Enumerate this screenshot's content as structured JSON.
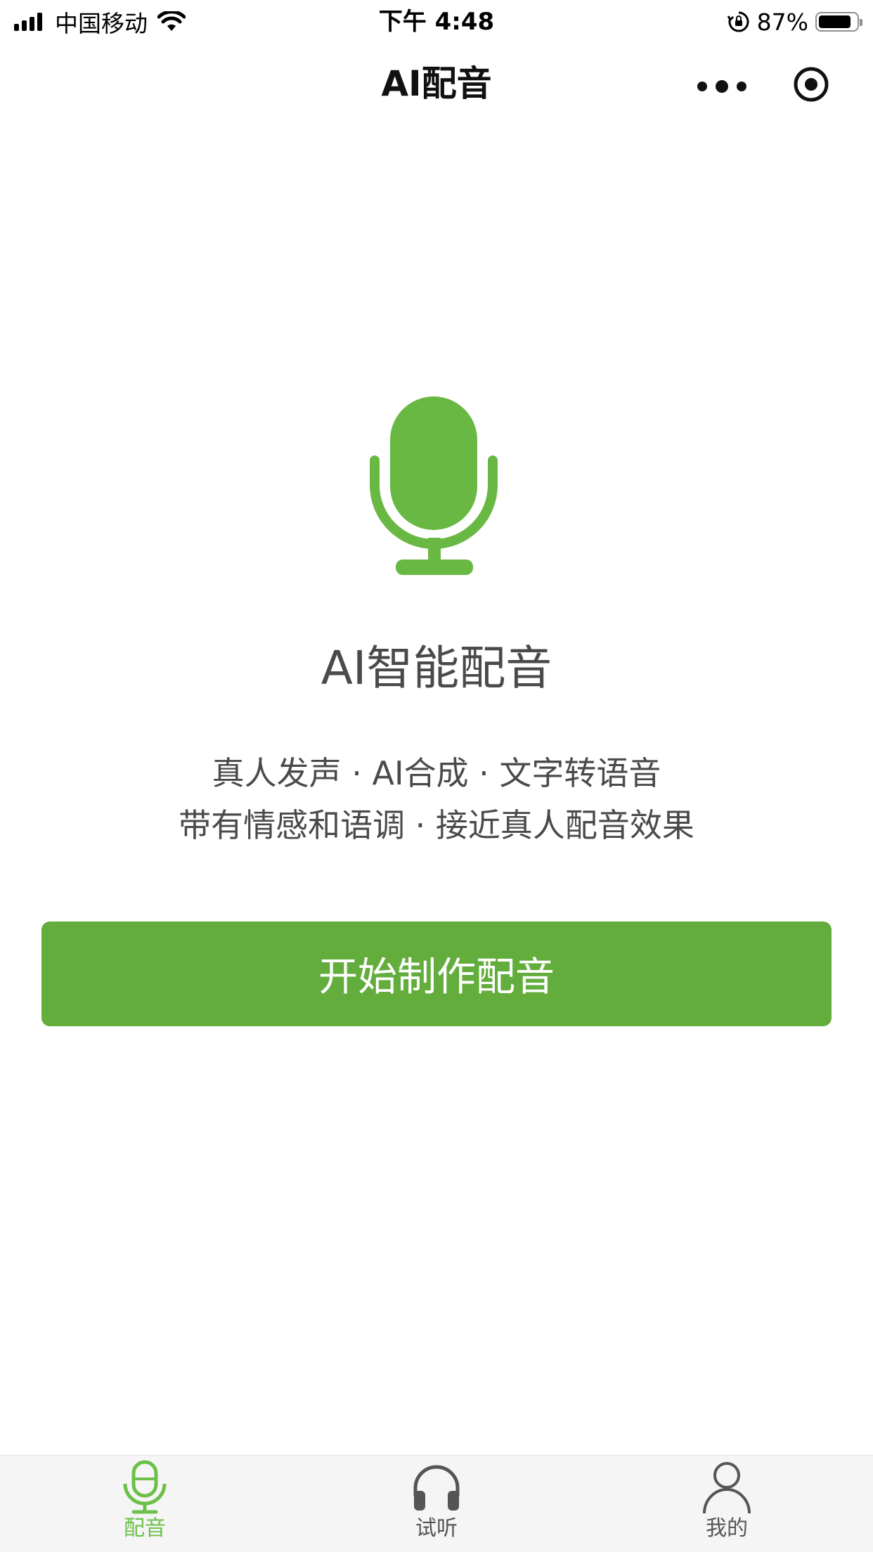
{
  "status_bar": {
    "carrier": "中国移动",
    "time": "下午 4:48",
    "battery_percent": "87%",
    "battery_level": 0.87
  },
  "nav": {
    "title": "AI配音",
    "more_icon": "more-dots-icon",
    "target_icon": "record-target-icon"
  },
  "hero": {
    "icon": "microphone-icon",
    "title": "AI智能配音",
    "desc_line1": "真人发声 · AI合成 · 文字转语音",
    "desc_line2": "带有情感和语调 · 接近真人配音效果"
  },
  "start_button": {
    "label": "开始制作配音"
  },
  "tabs": [
    {
      "label": "配音",
      "icon": "microphone-icon",
      "active": true
    },
    {
      "label": "试听",
      "icon": "headphones-icon",
      "active": false
    },
    {
      "label": "我的",
      "icon": "user-icon",
      "active": false
    }
  ],
  "colors": {
    "brand_green": "#62ad3c",
    "active_tab": "#6cc04a",
    "inactive_tab": "#555555",
    "text_gray": "#4a4a4a"
  }
}
